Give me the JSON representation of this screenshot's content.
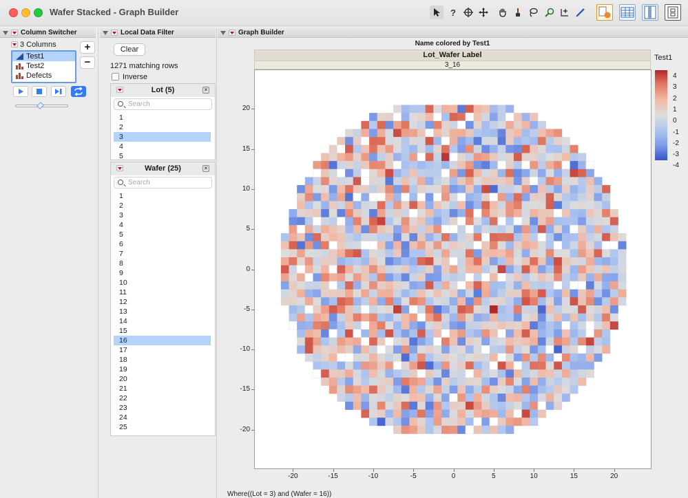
{
  "window": {
    "title": "Wafer Stacked - Graph Builder"
  },
  "toolbar": {
    "icons": [
      "arrow-tool-icon",
      "help-tool-icon",
      "crosshair-tool-icon",
      "grabber-tool-icon",
      "hand-tool-icon",
      "lasso-tool-icon",
      "brush-tool-icon",
      "magnifier-tool-icon",
      "scaler-tool-icon",
      "annotate-tool-icon",
      "report-icon",
      "data-table-icon",
      "column-viewer-icon",
      "layout-icon"
    ]
  },
  "column_switcher": {
    "header": "Column Switcher",
    "count_label": "3 Columns",
    "columns": [
      {
        "label": "Test1",
        "icon": "continuous-column-icon",
        "selected": true
      },
      {
        "label": "Test2",
        "icon": "bar-column-icon",
        "selected": false
      },
      {
        "label": "Defects",
        "icon": "bar-column-icon",
        "selected": false
      }
    ],
    "add_label": "+",
    "remove_label": "−"
  },
  "local_filter": {
    "header": "Local Data Filter",
    "clear_label": "Clear",
    "matching_text": "1271 matching rows",
    "inverse_label": "Inverse",
    "lot": {
      "title": "Lot (5)",
      "search_placeholder": "Search",
      "items": [
        "1",
        "2",
        "3",
        "4",
        "5"
      ],
      "selected": "3"
    },
    "wafer": {
      "title": "Wafer (25)",
      "search_placeholder": "Search",
      "items": [
        "1",
        "2",
        "3",
        "4",
        "5",
        "6",
        "7",
        "8",
        "9",
        "10",
        "11",
        "12",
        "13",
        "14",
        "15",
        "16",
        "17",
        "18",
        "19",
        "20",
        "21",
        "22",
        "23",
        "24",
        "25"
      ],
      "selected": "16"
    }
  },
  "graph_builder": {
    "header": "Graph Builder",
    "plot_title": "Name colored by Test1",
    "group_header": "Lot_Wafer Label",
    "group_value": "3_16",
    "legend_title": "Test1",
    "legend_ticks": [
      "4",
      "3",
      "2",
      "1",
      "0",
      "-1",
      "-2",
      "-3",
      "-4"
    ],
    "where_clause": "Where((Lot = 3) and (Wafer = 16))"
  },
  "colors": {
    "selection": "#b4d3fb",
    "accent_blue": "#2f7cf6",
    "high": "#b3262a",
    "neutral": "#dcdcdc",
    "low": "#3554c8"
  },
  "chart_data": {
    "type": "heatmap",
    "title": "Name colored by Test1",
    "color_variable": "Test1",
    "color_range": [
      -4,
      4
    ],
    "xlim": [
      -22,
      22
    ],
    "ylim": [
      -22,
      22
    ],
    "x_ticks": [
      "-20",
      "-15",
      "-10",
      "-5",
      "0",
      "5",
      "10",
      "15",
      "20"
    ],
    "y_ticks": [
      "20",
      "15",
      "10",
      "5",
      "0",
      "-5",
      "-10",
      "-15",
      "-20"
    ],
    "die_grid": {
      "x_range": [
        -21,
        21
      ],
      "y_range": [
        -20,
        20
      ],
      "radius": 21.5
    },
    "notable_cells": [
      {
        "x": 5,
        "y": -5,
        "value": 4
      },
      {
        "x": -8,
        "y": 12,
        "value": 3
      },
      {
        "x": 13,
        "y": -10,
        "value": -3.5
      },
      {
        "x": -6,
        "y": -15,
        "value": -3
      },
      {
        "x": 6,
        "y": -12,
        "value": 2.8
      }
    ]
  }
}
